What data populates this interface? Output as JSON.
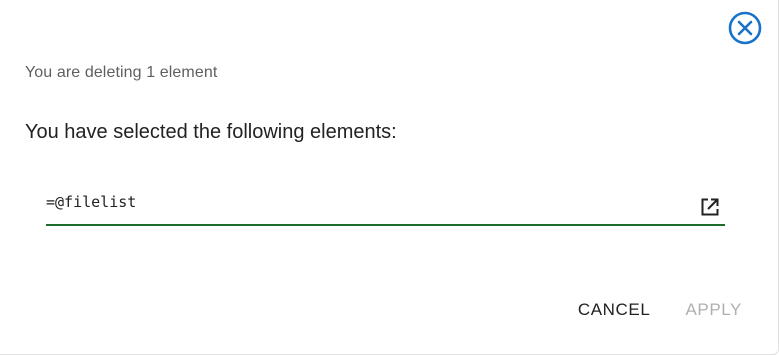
{
  "dialog": {
    "subtitle": "You are deleting 1 element",
    "heading": "You have selected the following elements:",
    "field_value": "=@filelist",
    "field_underline_color": "#1e6b2e",
    "close_icon": "close-circle-icon",
    "open_icon": "open-in-new-icon",
    "accent_color": "#1a73c8"
  },
  "actions": {
    "cancel_label": "CANCEL",
    "apply_label": "APPLY",
    "apply_disabled": true
  }
}
